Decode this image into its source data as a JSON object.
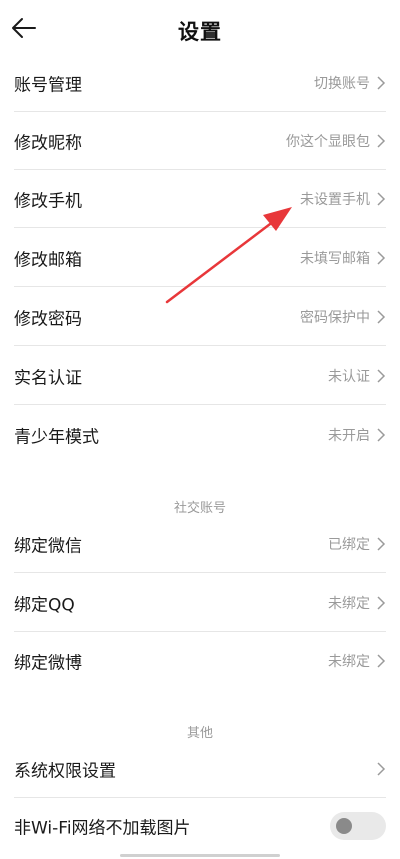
{
  "header": {
    "title": "设置"
  },
  "account_rows": [
    {
      "label": "账号管理",
      "value": "切换账号"
    },
    {
      "label": "修改昵称",
      "value": "你这个显眼包"
    },
    {
      "label": "修改手机",
      "value": "未设置手机"
    },
    {
      "label": "修改邮箱",
      "value": "未填写邮箱"
    },
    {
      "label": "修改密码",
      "value": "密码保护中"
    },
    {
      "label": "实名认证",
      "value": "未认证"
    },
    {
      "label": "青少年模式",
      "value": "未开启"
    }
  ],
  "social": {
    "section_title": "社交账号",
    "rows": [
      {
        "label": "绑定微信",
        "value": "已绑定"
      },
      {
        "label": "绑定QQ",
        "value": "未绑定"
      },
      {
        "label": "绑定微博",
        "value": "未绑定"
      }
    ]
  },
  "other": {
    "section_title": "其他",
    "permissions_label": "系统权限设置",
    "no_image_label": "非Wi-Fi网络不加载图片",
    "no_image_enabled": false
  },
  "colors": {
    "annotation_arrow": "#e8373a",
    "divider": "#e6e6e6",
    "secondary_text": "#9a9a9a"
  },
  "icons": {
    "back": "left-arrow-icon",
    "chevron": "chevron-right-icon"
  }
}
